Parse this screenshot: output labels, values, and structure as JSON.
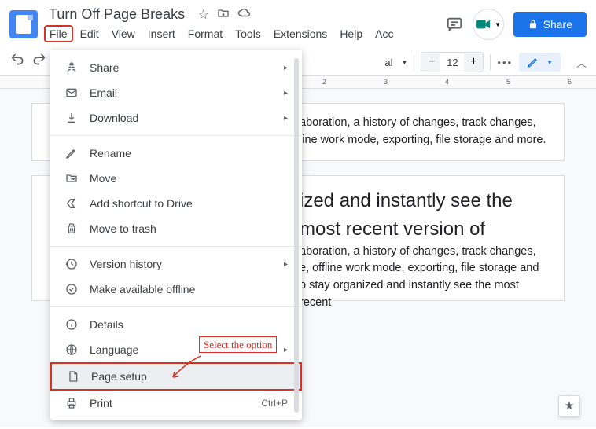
{
  "header": {
    "doc_title": "Turn Off Page Breaks",
    "share_label": "Share"
  },
  "menubar": {
    "items": [
      "File",
      "Edit",
      "View",
      "Insert",
      "Format",
      "Tools",
      "Extensions",
      "Help",
      "Acc"
    ]
  },
  "toolbar": {
    "font_style_partial": "al",
    "font_size": "12"
  },
  "ruler": {
    "marks": [
      "2",
      "3",
      "4",
      "5",
      "6"
    ]
  },
  "file_menu": {
    "groups": [
      [
        {
          "icon": "share",
          "label": "Share",
          "submenu": true
        },
        {
          "icon": "email",
          "label": "Email",
          "submenu": true
        },
        {
          "icon": "download",
          "label": "Download",
          "submenu": true
        }
      ],
      [
        {
          "icon": "rename",
          "label": "Rename"
        },
        {
          "icon": "move",
          "label": "Move"
        },
        {
          "icon": "shortcut",
          "label": "Add shortcut to Drive"
        },
        {
          "icon": "trash",
          "label": "Move to trash"
        }
      ],
      [
        {
          "icon": "history",
          "label": "Version history",
          "submenu": true
        },
        {
          "icon": "offline",
          "label": "Make available offline"
        }
      ],
      [
        {
          "icon": "details",
          "label": "Details"
        },
        {
          "icon": "language",
          "label": "Language",
          "submenu": true
        },
        {
          "icon": "page-setup",
          "label": "Page setup",
          "hovered": true,
          "boxed": true
        },
        {
          "icon": "print",
          "label": "Print",
          "shortcut": "Ctrl+P"
        }
      ]
    ]
  },
  "annotation": {
    "text": "Select the option"
  },
  "document": {
    "page1_text": "aboration, a history of changes, track changes, line work mode, exporting, file storage and more.",
    "page2_text1": "ized and instantly see the most recent version of",
    "page2_text2": "aboration, a history of changes, track changes, e, offline work mode, exporting, file storage and o stay organized and instantly see the most recent"
  }
}
